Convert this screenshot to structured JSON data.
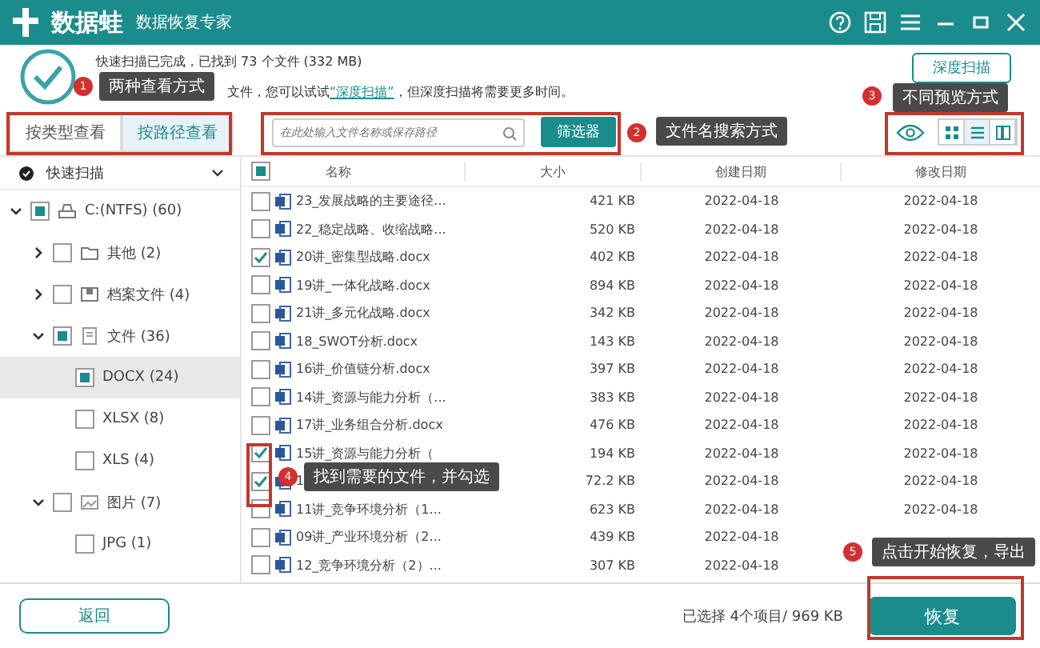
{
  "window": {
    "title": "数据蛙",
    "subtitle": "数据恢复专家"
  },
  "status": {
    "line1": "快速扫描已完成，已找到 73 个文件 (332 MB)",
    "line2": "文件，您可以试试",
    "link": "“深度扫描”",
    "line2_end": "，但深度扫描将需要更多时间。",
    "deep_scan_button": "深度扫描"
  },
  "view_tabs": [
    {
      "label": "按类型查看",
      "selected": false
    },
    {
      "label": "按路径查看",
      "selected": true
    }
  ],
  "search": {
    "placeholder": "在此处输入文件名称或保存路径"
  },
  "filter_button": "筛选器",
  "view_modes": [
    {
      "kind": "grid",
      "selected": false
    },
    {
      "kind": "list",
      "selected": true
    },
    {
      "kind": "detail",
      "selected": false
    }
  ],
  "scan_selector": {
    "label": "快速扫描"
  },
  "tree": [
    {
      "label": "C:(NTFS) (60)",
      "kind": "drive",
      "checked": true,
      "expanded": true,
      "selected": false,
      "children": [
        {
          "label": "其他 (2)",
          "kind": "folder",
          "checked": false,
          "expanded": false,
          "selected": false
        },
        {
          "label": "档案文件 (4)",
          "kind": "archive",
          "checked": false,
          "expanded": false,
          "selected": false
        },
        {
          "label": "文件 (36)",
          "kind": "doc",
          "checked": true,
          "expanded": true,
          "selected": false,
          "children": [
            {
              "label": "DOCX (24)",
              "checked": true,
              "selected": true
            },
            {
              "label": "XLSX (8)",
              "checked": false,
              "selected": false
            },
            {
              "label": "XLS (4)",
              "checked": false,
              "selected": false
            }
          ]
        },
        {
          "label": "图片 (7)",
          "kind": "image",
          "checked": false,
          "expanded": true,
          "selected": false,
          "children": [
            {
              "label": "JPG (1)",
              "checked": false,
              "selected": false
            }
          ]
        }
      ]
    }
  ],
  "table": {
    "columns": [
      "名称",
      "大小",
      "创建日期",
      "修改日期"
    ],
    "all_checked": true,
    "rows": [
      {
        "name": "23_发展战略的主要途径...",
        "size": "421 KB",
        "created": "2022-04-18",
        "modified": "2022-04-18",
        "checked": false
      },
      {
        "name": "22_稳定战略、收缩战略...",
        "size": "520 KB",
        "created": "2022-04-18",
        "modified": "2022-04-18",
        "checked": false
      },
      {
        "name": "20讲_密集型战略.docx",
        "size": "402 KB",
        "created": "2022-04-18",
        "modified": "2022-04-18",
        "checked": true
      },
      {
        "name": "19讲_一体化战略.docx",
        "size": "894 KB",
        "created": "2022-04-18",
        "modified": "2022-04-18",
        "checked": false
      },
      {
        "name": "21讲_多元化战略.docx",
        "size": "342 KB",
        "created": "2022-04-18",
        "modified": "2022-04-18",
        "checked": false
      },
      {
        "name": "18_SWOT分析.docx",
        "size": "143 KB",
        "created": "2022-04-18",
        "modified": "2022-04-18",
        "checked": false
      },
      {
        "name": "16讲_价值链分析.docx",
        "size": "397 KB",
        "created": "2022-04-18",
        "modified": "2022-04-18",
        "checked": false
      },
      {
        "name": "14讲_资源与能力分析（...",
        "size": "383 KB",
        "created": "2022-04-18",
        "modified": "2022-04-18",
        "checked": false
      },
      {
        "name": "17讲_业务组合分析.docx",
        "size": "476 KB",
        "created": "2022-04-18",
        "modified": "2022-04-18",
        "checked": false
      },
      {
        "name": "15讲_资源与能力分析（",
        "size": "194 KB",
        "created": "2022-04-18",
        "modified": "2022-04-18",
        "checked": true
      },
      {
        "name": "1",
        "size": "72.2 KB",
        "created": "2022-04-18",
        "modified": "2022-04-18",
        "checked": true
      },
      {
        "name": "11讲_竞争环境分析（1...",
        "size": "623 KB",
        "created": "2022-04-18",
        "modified": "2022-04-18",
        "checked": false
      },
      {
        "name": "09讲_产业环境分析（2...",
        "size": "439 KB",
        "created": "2022-04-18",
        "checked": false
      },
      {
        "name": "12_竞争环境分析（2）...",
        "size": "307 KB",
        "created": "2022-04-18",
        "checked": false
      }
    ]
  },
  "footer": {
    "back_button": "返回",
    "selection": "已选择 4个项目/ 969 KB",
    "recover_button": "恢复"
  },
  "callouts": [
    {
      "number": "1",
      "text": "两种查看方式"
    },
    {
      "number": "2",
      "text": "文件名搜索方式"
    },
    {
      "number": "3",
      "text": "不同预览方式"
    },
    {
      "number": "4",
      "text": "找到需要的文件，并勾选"
    },
    {
      "number": "5",
      "text": "点击开始恢复，导出"
    }
  ]
}
